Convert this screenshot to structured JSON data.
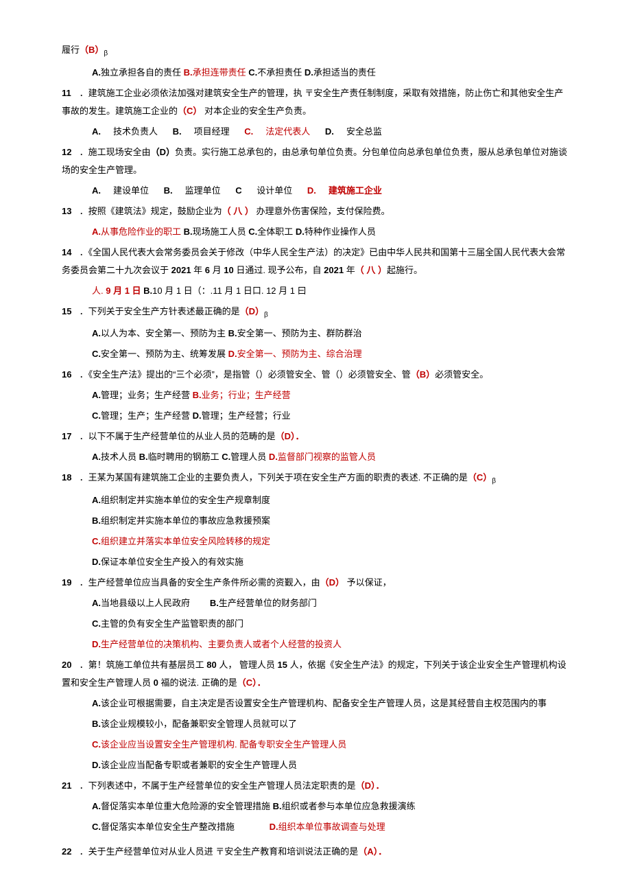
{
  "frag_top": "履行",
  "frag_top_ans": "（B）",
  "frag_top_sub": "β",
  "frag_top_opts": {
    "a_lbl": "A.",
    "a": "独立承担各自的责任 ",
    "b_lbl": "B.",
    "b": "承担连带责任 ",
    "c_lbl": "C.",
    "c": "不承担责任 ",
    "d_lbl": "D.",
    "d": "承担适当的责任"
  },
  "q11": {
    "num": "11",
    "text1": " ．建筑施工企业必须依法加强对建筑安全生产的管理，执 〒安全生产责任制制度，采取有效措施，防止伤亡和其他安全生产事故的发生。建筑施工企业的",
    "ans": "（C）",
    "text2": " 对本企业的安全生产负责。",
    "a_lbl": "A.",
    "a": "技术负责人",
    "b_lbl": "B.",
    "b": "项目经理",
    "c_lbl": "C.",
    "c": "法定代表人",
    "d_lbl": "D.",
    "d": "安全总监"
  },
  "q12": {
    "num": "12",
    "text1": " ．施工现场安全由",
    "ans": "（D）",
    "text2": "负责。实行施工总承包的，由总承句单位负责。分包单位向总承包单位负责，服从总承包单位对施谈场的安全生产管理。",
    "a_lbl": "A.",
    "a": "建设单位",
    "b_lbl": "B.",
    "b": "监理单位",
    "c_lbl": "C",
    "c": " 设计单位",
    "d_lbl": "D.",
    "d": "建筑施工企业"
  },
  "q13": {
    "num": "13",
    "text1": " ．按照《建筑法》规定，鼓励企业为",
    "ans": "（ 八 ）",
    "text2": " 办理意外伤害保险，支付保险费。",
    "a_lbl": "A.",
    "a": "从事危险作业的职工 ",
    "b_lbl": "B.",
    "b": "现场施工人员 ",
    "c_lbl": "C.",
    "c": "全体职工 ",
    "d_lbl": "D.",
    "d": "特种作业操作人员"
  },
  "q14": {
    "num": "14",
    "text1": " ．《全国人民代表大会常务委员会关于修改（中华人民全生产法）的决定》已由中华人民共和国第十三届全国人民代表大会常务委员会第二十九次会议于 ",
    "bold1": "2021",
    "text2": " 年 ",
    "bold2": "6",
    "text3": " 月 ",
    "bold3": "10",
    "text4": " 日通过. 现予公布，自 ",
    "bold4": "2021",
    "text5": " 年",
    "ans": "（ 八 ）",
    "text6": "起施行。",
    "opts_pre": "人. ",
    "opts_a": "9 月 1 日 ",
    "opts_b_lbl": "B.",
    "opts_b": "10 月 1 日（：.11 月 1 日口. 12 月 1 曰"
  },
  "q15": {
    "num": "15",
    "text1": " ．下列关于安全生产方针表述最正确的是",
    "ans": "（D）",
    "sub": "β",
    "a_lbl": "A.",
    "a": "以人为本、安全第一、预防为主 ",
    "b_lbl": "B.",
    "b": "安全第一、预防为主、群防群治",
    "c_lbl": "C.",
    "c": "安全第一、预防为主、统筹发展 ",
    "d_lbl": "D.",
    "d": "安全第一、预防为主、综合治理"
  },
  "q16": {
    "num": "16",
    "text1": " ．《安全生产法》提出的“三个必须”，是指管（）必须管安全、管（）必须管安全、管",
    "ans": "（B）",
    "text2": "必须管安全。",
    "a_lbl": "A.",
    "a": "管理；业务；生产经营 ",
    "b_lbl": "B.",
    "b": "业务；行业；生产经营",
    "c_lbl": "C.",
    "c": "管理；生产；生产经营 ",
    "d_lbl": "D.",
    "d": "管理；生产经营；行业"
  },
  "q17": {
    "num": "17",
    "text1": " ．以下不属于生产经营单位的从业人员的范畴的是",
    "ans": "（D）．",
    "a_lbl": "A.",
    "a": "技术人员 ",
    "b_lbl": "B.",
    "b": "临时聘用的钢筋工 ",
    "c_lbl": "C.",
    "c": "管理人员 ",
    "d_lbl": "D.",
    "d": "监督部门视察的监管人员"
  },
  "q18": {
    "num": "18",
    "text1": " ．王某为某国有建筑施工企业的主要负责人，下列关于项在安全生产方面的职责的表述. 不正确的是",
    "ans": "（C）",
    "sub": "β",
    "a_lbl": "A.",
    "a": "组织制定并实施本单位的安全生产规章制度",
    "b_lbl": "B.",
    "b": "组织制定并实施本单位的事故应急救援预案",
    "c_lbl": "C.",
    "c": "组织建立并落实本单位安全风险转移的规定",
    "d_lbl": "D.",
    "d": "保证本单位安全生产投入的有效实施"
  },
  "q19": {
    "num": "19",
    "text1": " ．生产经营单位应当具备的安全生产条件所必需的资觐入，由",
    "ans": "（D）",
    "text2": " 予以保证，",
    "a_lbl": "A.",
    "a": "当地县级以上人民政府",
    "b_lbl": "B.",
    "b": "生产经营单位的财务部门",
    "c_lbl": "C.",
    "c": "主管的负有安全生产监管职责的部门",
    "d_lbl": "D.",
    "d": "生产经营单位的决策机构、主要负责人或者个人经营的投资人"
  },
  "q20": {
    "num": "20",
    "text1": " ．第！筑施工单位共有基层员工 ",
    "bold1": "80",
    "text2": " 人， 管理人员 ",
    "bold2": "15",
    "text3": " 人，依据《安全生产法》的规定，下列关于该企业安全生产管理机构设置和安全生产管理人员 ",
    "bold3": "0",
    "text4": " 福的说法. 正确的是",
    "ans": "（C）．",
    "a_lbl": "A.",
    "a": "该企业可根据需要，自主决定是否设置安全生产管理机构、配备安全生产管理人员，这是其经营自主权范围内的事",
    "b_lbl": "B.",
    "b": "该企业规模较小，配备兼职安全管理人员就可以了",
    "c_lbl": "C.",
    "c": "该企业应当设置安全生产管理机构. 配备专职安全生产管理人员",
    "d_lbl": "D.",
    "d": "该企业应当配备专职或者兼职的安全生产管理人员"
  },
  "q21": {
    "num": "21",
    "text1": " ．下列表述中，不属于生产经营单位的安全生产管理人员法定职责的是",
    "ans": "（D）．",
    "a_lbl": "A.",
    "a": "督促落实本单位重大危险源的安全管理措施 ",
    "b_lbl": "B.",
    "b": "组织或者参与本单位应急救援演练",
    "c_lbl": "C.",
    "c": "督促落实本单位安全生产整改措施",
    "d_lbl": "D.",
    "d": "组织本单位事故调查与处理"
  },
  "q22": {
    "num": "22",
    "text1": " ．关于生产经营单位对从业人员进 〒安全生产教育和培训说法正确的是",
    "ans": "（A）．"
  }
}
